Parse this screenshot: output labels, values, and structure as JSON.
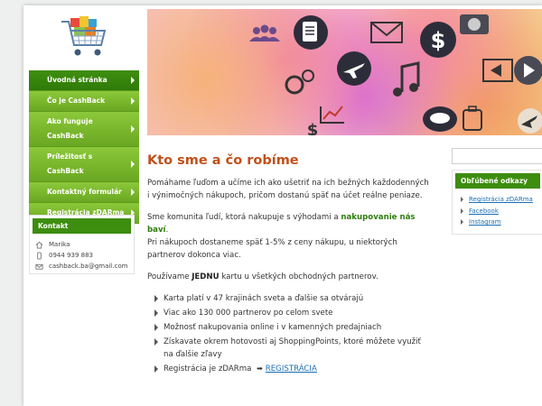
{
  "nav": {
    "items": [
      {
        "label": "Úvodná stránka",
        "active": true
      },
      {
        "label": "Čo je CashBack",
        "active": false
      },
      {
        "label": "Ako funguje CashBack",
        "active": false
      },
      {
        "label": "Príležitosť s CashBack",
        "active": false
      },
      {
        "label": "Kontaktný formulár",
        "active": false
      },
      {
        "label": "Registrácia zDARma",
        "active": false
      }
    ]
  },
  "contact": {
    "heading": "Kontakt",
    "name": "Marika",
    "phone": "0944 939 883",
    "email": "cashback.ba@gmail.com"
  },
  "main": {
    "title": "Kto sme a čo robíme",
    "p1": "Pomáhame ľuďom a učíme ich ako ušetriť na ich bežných každodenných i výnimočných nákupoch, pričom dostanú späť na účet reálne peniaze.",
    "p2_a": "Sme komunita ľudí, ktorá nakupuje s výhodami a ",
    "p2_b": "nakupovanie nás baví",
    "p2_c": ".",
    "p2_d": "Pri nákupoch dostaneme späť 1-5% z ceny nákupu, u niektorých partnerov dokonca viac.",
    "p3_a": "Používame ",
    "p3_b": "JEDNU",
    "p3_c": " kartu u všetkých obchodných partnerov.",
    "bullets": [
      "Karta platí v 47 krajinách sveta a ďalšie sa otvárajú",
      "Viac ako 130 000 partnerov po celom svete",
      "Možnosť nakupovania online i v kamenných predajniach",
      "Získavate okrem hotovosti aj ShoppingPoints, ktoré môžete využiť na ďalšie zľavy"
    ],
    "reg_text": "Registrácia je zDARma",
    "reg_arrow": "➡",
    "reg_link": "REGISTRÁCIA"
  },
  "sidebar_right": {
    "search_placeholder": "",
    "fav_heading": "Obľúbené odkazy",
    "links": [
      "Registrácia zDARma",
      "Facebook",
      "Instagram"
    ]
  },
  "colors": {
    "accent_green": "#3d8d0f",
    "nav_green": "#6aa722",
    "title_orange": "#c0511b",
    "link_blue": "#1a6fb5"
  }
}
